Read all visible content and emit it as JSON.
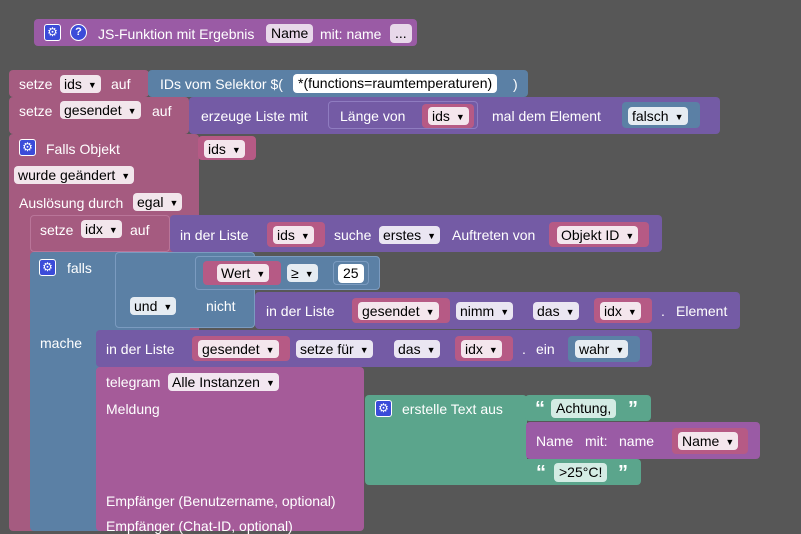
{
  "func": {
    "prefix": "JS-Funktion mit Ergebnis",
    "name_field": "Name",
    "mit": "mit: name",
    "more": "..."
  },
  "set_ids": {
    "setze": "setze",
    "var": "ids",
    "auf": "auf",
    "selector_label": "IDs vom Selektor $(",
    "selector_value": "*(functions=raumtemperaturen)",
    "close": ")"
  },
  "set_gesendet": {
    "setze": "setze",
    "var": "gesendet",
    "auf": "auf",
    "create": "erzeuge Liste mit",
    "length": "Länge von",
    "ids": "ids",
    "times": "mal dem Element",
    "false_val": "falsch"
  },
  "trigger": {
    "falls_objekt": "Falls Objekt",
    "ids": "ids",
    "changed": "wurde geändert",
    "ausloesung": "Auslösung durch",
    "egal": "egal"
  },
  "set_idx": {
    "setze": "setze",
    "var": "idx",
    "auf": "auf",
    "in_list": "in der Liste",
    "ids": "ids",
    "search": "suche",
    "first": "erstes",
    "occ": "Auftreten von",
    "obj": "Objekt ID"
  },
  "if_block": {
    "falls": "falls",
    "mache": "mache",
    "wert": "Wert",
    "op": "≥",
    "num": "25",
    "und": "und",
    "nicht": "nicht",
    "in_list": "in der Liste",
    "gesendet": "gesendet",
    "take": "nimm",
    "das": "das",
    "idx": "idx",
    "dot": ".",
    "element": "Element"
  },
  "set_list": {
    "in_list": "in der Liste",
    "gesendet": "gesendet",
    "set_for": "setze für",
    "das": "das",
    "idx": "idx",
    "dot": ".",
    "ein": "ein",
    "wahr": "wahr"
  },
  "telegram": {
    "label": "telegram",
    "instances": "Alle Instanzen",
    "meldung": "Meldung",
    "text_create": "erstelle Text aus",
    "achtung": "Achtung,",
    "name_call": "Name",
    "mit": "mit:",
    "name_param": "name",
    "name_var": "Name",
    "temp": ">25°C!",
    "recipient_user": "Empfänger (Benutzername, optional)",
    "recipient_chat": "Empfänger (Chat-ID, optional)"
  }
}
